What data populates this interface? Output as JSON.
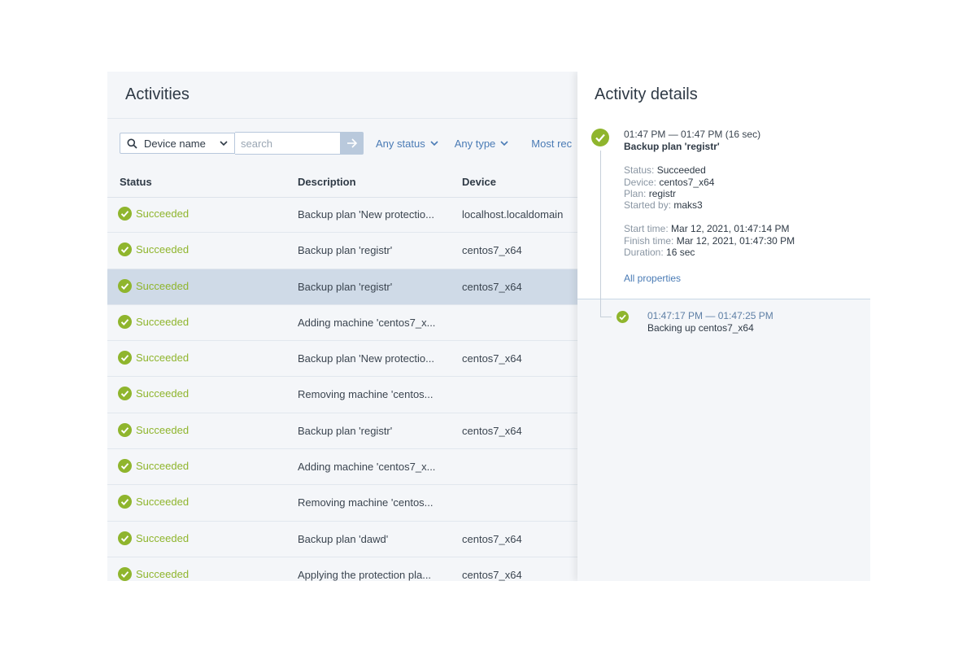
{
  "activities": {
    "title": "Activities",
    "device_select": {
      "label": "Device name"
    },
    "search": {
      "placeholder": "search"
    },
    "filters": {
      "status": "Any status",
      "type": "Any type",
      "sort": "Most rec"
    },
    "columns": {
      "status": "Status",
      "description": "Description",
      "device": "Device"
    },
    "rows": [
      {
        "status": "Succeeded",
        "description": "Backup plan 'New protectio...",
        "device": "localhost.localdomain"
      },
      {
        "status": "Succeeded",
        "description": "Backup plan 'registr'",
        "device": "centos7_x64"
      },
      {
        "status": "Succeeded",
        "description": "Backup plan 'registr'",
        "device": "centos7_x64"
      },
      {
        "status": "Succeeded",
        "description": "Adding machine 'centos7_x...",
        "device": ""
      },
      {
        "status": "Succeeded",
        "description": "Backup plan 'New protectio...",
        "device": "centos7_x64"
      },
      {
        "status": "Succeeded",
        "description": "Removing machine 'centos...",
        "device": ""
      },
      {
        "status": "Succeeded",
        "description": "Backup plan 'registr'",
        "device": "centos7_x64"
      },
      {
        "status": "Succeeded",
        "description": "Adding machine 'centos7_x...",
        "device": ""
      },
      {
        "status": "Succeeded",
        "description": "Removing machine 'centos...",
        "device": ""
      },
      {
        "status": "Succeeded",
        "description": "Backup plan 'dawd'",
        "device": "centos7_x64"
      },
      {
        "status": "Succeeded",
        "description": "Applying the protection pla...",
        "device": "centos7_x64"
      }
    ],
    "selected_row": 2
  },
  "details": {
    "title": "Activity details",
    "time": "01:47 PM — 01:47 PM (16 sec)",
    "name": "Backup plan 'registr'",
    "fields": [
      {
        "k": "Status:",
        "v": "Succeeded"
      },
      {
        "k": "Device:",
        "v": "centos7_x64"
      },
      {
        "k": "Plan:",
        "v": "registr"
      },
      {
        "k": "Started by:",
        "v": "maks3"
      }
    ],
    "times": [
      {
        "k": "Start time:",
        "v": "Mar 12, 2021, 01:47:14 PM"
      },
      {
        "k": "Finish time:",
        "v": "Mar 12, 2021, 01:47:30 PM"
      },
      {
        "k": "Duration:",
        "v": "16 sec"
      }
    ],
    "all_properties": "All properties",
    "sub": {
      "time": "01:47:17 PM — 01:47:25 PM",
      "desc": "Backing up centos7_x64"
    }
  },
  "colors": {
    "success": "#8fb52d",
    "link": "#4a7bb5",
    "selected_row": "#cfdae7"
  },
  "icons": {
    "search": "search-icon",
    "chevron": "chevron-down-icon",
    "arrow": "arrow-right-icon",
    "check": "check-circle-icon"
  }
}
